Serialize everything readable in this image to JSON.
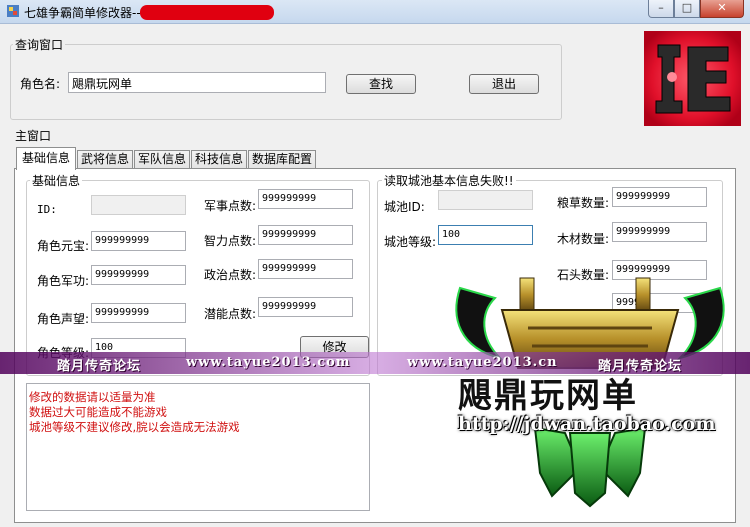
{
  "window": {
    "title": "七雄争霸简单修改器--",
    "controls": {
      "minimize": "–",
      "maximize": "□",
      "close": "✕"
    }
  },
  "query": {
    "group_label": "查询窗口",
    "role_label": "角色名:",
    "role_value": "飓鼎玩网单",
    "search_button": "查找",
    "exit_button": "退出"
  },
  "main": {
    "group_label": "主窗口",
    "tabs": [
      {
        "label": "基础信息",
        "active": true
      },
      {
        "label": "武将信息",
        "active": false
      },
      {
        "label": "军队信息",
        "active": false
      },
      {
        "label": "科技信息",
        "active": false
      },
      {
        "label": "数据库配置",
        "active": false
      }
    ],
    "basic": {
      "group_label": "基础信息",
      "id_label": "ID:",
      "id_value": "",
      "yuanbao_label": "角色元宝:",
      "yuanbao_value": "999999999",
      "jungong_label": "角色军功:",
      "jungong_value": "999999999",
      "shengwang_label": "角色声望:",
      "shengwang_value": "999999999",
      "dengji_label": "角色等级:",
      "dengji_value": "100",
      "junshi_label": "军事点数:",
      "junshi_value": "999999999",
      "zhili_label": "智力点数:",
      "zhili_value": "999999999",
      "zhengzhi_label": "政治点数:",
      "zhengzhi_value": "999999999",
      "qianneng_label": "潜能点数:",
      "qianneng_value": "999999999",
      "modify_button": "修改"
    },
    "city": {
      "group_label": "读取城池基本信息失败!!",
      "city_id_label": "城池ID:",
      "city_id_value": "",
      "city_level_label": "城池等级:",
      "city_level_value": "100",
      "grain_label": "粮草数量:",
      "grain_value": "999999999",
      "wood_label": "木材数量:",
      "wood_value": "999999999",
      "stone_label": "石头数量:",
      "stone_value": "999999999",
      "fourth_value": "99999"
    },
    "notes": [
      "修改的数据请以适量为准",
      "数据过大可能造成不能游戏",
      "城池等级不建议修改,脘以会造成无法游戏"
    ]
  },
  "overlay": {
    "banner_left_text": "踏月传奇论坛",
    "banner_url_1": "www.tayue2013.com",
    "banner_url_2": "www.tayue2013.cn",
    "banner_right_text": "踏月传奇论坛",
    "brand_text": "飓鼎玩网单",
    "brand_url": "http://jdwan.taobao.com",
    "logo_icon": "red-seal-logo-icon",
    "watermark_icon": "bronze-tripod-watermark-icon"
  }
}
